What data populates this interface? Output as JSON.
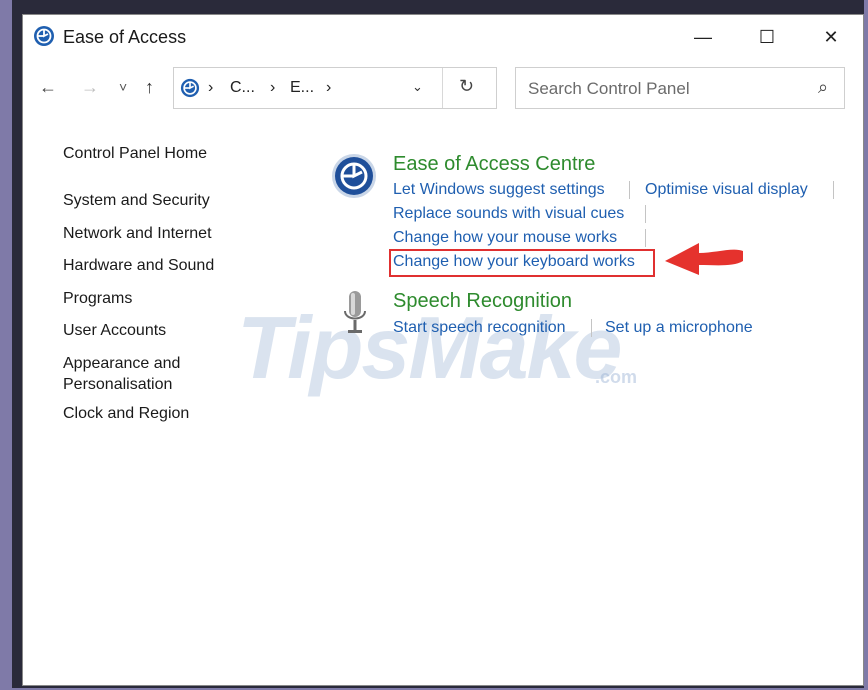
{
  "window": {
    "title": "Ease of Access",
    "controls": {
      "minimize": "—",
      "maximize": "☐",
      "close": "✕"
    }
  },
  "navigation": {
    "back": "←",
    "forward": "→",
    "recent": "˅",
    "up": "↑"
  },
  "address_bar": {
    "crumbs": [
      "C...",
      "E..."
    ],
    "separator": "›",
    "dropdown": "⌄",
    "refresh": "↻"
  },
  "search": {
    "placeholder": "Search Control Panel",
    "icon": "⌕"
  },
  "sidebar": {
    "items": [
      "Control Panel Home",
      "System and Security",
      "Network and Internet",
      "Hardware and Sound",
      "Programs",
      "User Accounts",
      "Appearance and",
      "Personalisation",
      "Clock and Region"
    ]
  },
  "categories": {
    "ease": {
      "title": "Ease of Access Centre",
      "tasks": [
        "Let Windows suggest settings",
        "Optimise visual display",
        "Replace sounds with visual cues",
        "Change how your mouse works",
        "Change how your keyboard works"
      ]
    },
    "speech": {
      "title": "Speech Recognition",
      "tasks": [
        "Start speech recognition",
        "Set up a microphone"
      ]
    }
  },
  "watermark": {
    "main": "TipsMake",
    "suffix": ".com"
  },
  "colors": {
    "category_title": "#2e8b2e",
    "link": "#1f5fb0",
    "highlight": "#e03030"
  },
  "icons": {
    "title": "ease-of-access-icon",
    "ease_category": "ease-of-access-icon",
    "speech_category": "microphone-icon",
    "annotation": "red-arrow-icon"
  }
}
